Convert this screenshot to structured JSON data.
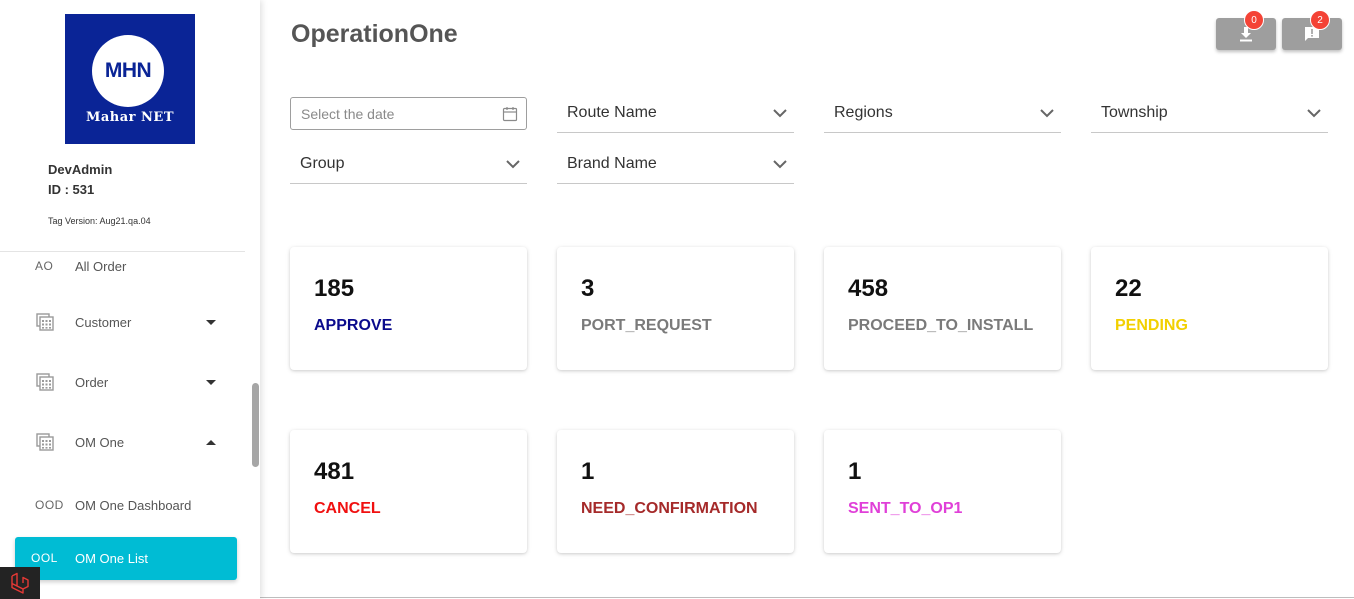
{
  "sidebar": {
    "logo": {
      "initials": "MHN",
      "brand": "Mahar NET"
    },
    "user": {
      "name": "DevAdmin",
      "id_label": "ID : 531",
      "tag_version": "Tag Version: Aug21.qa.04"
    },
    "items": [
      {
        "abbr": "AO",
        "label": "All Order"
      },
      {
        "label": "Customer",
        "icon": "calculator-icon",
        "caret": "down"
      },
      {
        "label": "Order",
        "icon": "calculator-icon",
        "caret": "down"
      },
      {
        "label": "OM One",
        "icon": "calculator-icon",
        "caret": "up"
      },
      {
        "abbr": "OOD",
        "label": "OM One Dashboard"
      },
      {
        "abbr": "OOL",
        "label": "OM One List",
        "active": true
      }
    ],
    "active_color": "#00bcd4"
  },
  "header": {
    "title": "OperationOne",
    "download": {
      "icon": "download-icon",
      "count": "0"
    },
    "feedback": {
      "icon": "feedback-icon",
      "count": "2"
    }
  },
  "filters": {
    "date_placeholder": "Select the date",
    "route_name": "Route Name",
    "regions": "Regions",
    "township": "Township",
    "group": "Group",
    "brand_name": "Brand Name"
  },
  "stats": [
    {
      "count": "185",
      "status": "APPROVE",
      "color": "#0a0a8c"
    },
    {
      "count": "3",
      "status": "PORT_REQUEST",
      "color": "#7a7a7a"
    },
    {
      "count": "458",
      "status": "PROCEED_TO_INSTALL",
      "color": "#7a7a7a"
    },
    {
      "count": "22",
      "status": "PENDING",
      "color": "#f2d000"
    },
    {
      "count": "481",
      "status": "CANCEL",
      "color": "#f01010"
    },
    {
      "count": "1",
      "status": "NEED_CONFIRMATION",
      "color": "#a52a2a"
    },
    {
      "count": "1",
      "status": "SENT_TO_OP1",
      "color": "#e040d8"
    }
  ]
}
